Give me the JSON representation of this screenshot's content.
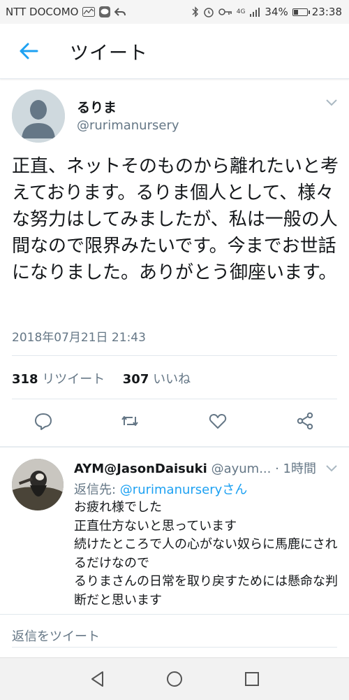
{
  "status_bar": {
    "carrier": "NTT DOCOMO",
    "network": "4G",
    "battery": "34%",
    "battery_level": 0.34,
    "time": "23:38"
  },
  "header": {
    "title": "ツイート",
    "back_icon": "arrow-left-icon",
    "accent_color": "#1da1f2"
  },
  "tweet": {
    "display_name": "るりま",
    "handle": "@rurimanursery",
    "text": "正直、ネットそのものから離れたいと考えております。るりま個人として、様々な努力はしてみましたが、私は一般の人間なので限界みたいです。今までお世話になりました。ありがとう御座います。",
    "timestamp": "2018年07月21日 21:43",
    "retweet_count": "318",
    "retweet_label": "リツイート",
    "like_count": "307",
    "like_label": "いいね",
    "actions": [
      "reply-icon",
      "retweet-icon",
      "like-icon",
      "share-icon"
    ]
  },
  "reply": {
    "name": "AYM@JasonDaisuki",
    "handle": "@ayum...",
    "time": "· 1時間",
    "reply_to_prefix": "返信先: ",
    "reply_to_link": "@rurimanurseryさん",
    "text": "お疲れ様でした\n正直仕方ないと思っています\n続けたところで人の心がない奴らに馬鹿にされるだけなので\nるりまさんの日常を取り戻すためには懸命な判断だと思います"
  },
  "compose": {
    "placeholder": "返信をツイート"
  },
  "nav": [
    "back-triangle-icon",
    "home-circle-icon",
    "recents-square-icon"
  ]
}
